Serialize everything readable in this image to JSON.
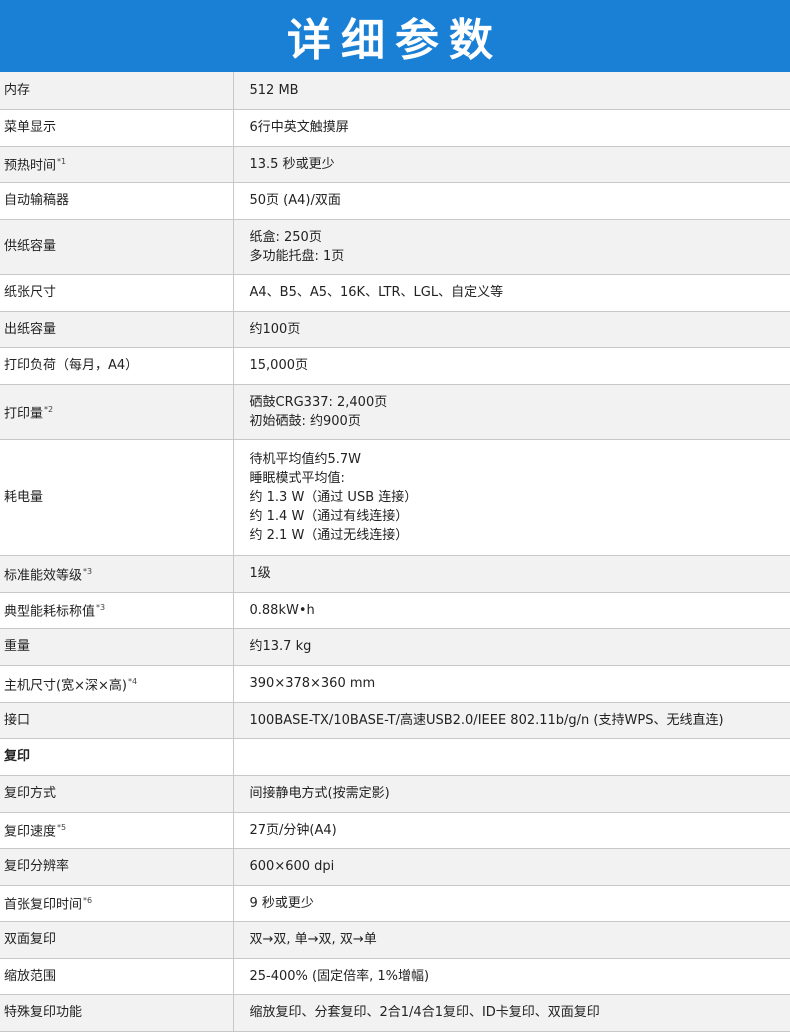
{
  "header": {
    "title": "详细参数"
  },
  "rows": [
    {
      "label": "内存",
      "fn": "",
      "lines": [
        "512 MB"
      ]
    },
    {
      "label": "菜单显示",
      "fn": "",
      "lines": [
        "6行中英文触摸屏"
      ]
    },
    {
      "label": "预热时间",
      "fn": "*1",
      "lines": [
        "13.5 秒或更少"
      ]
    },
    {
      "label": "自动输稿器",
      "fn": "",
      "lines": [
        "50页 (A4)/双面"
      ]
    },
    {
      "label": "供纸容量",
      "fn": "",
      "lines": [
        "纸盒: 250页",
        "多功能托盘: 1页"
      ]
    },
    {
      "label": "纸张尺寸",
      "fn": "",
      "lines": [
        "A4、B5、A5、16K、LTR、LGL、自定义等"
      ]
    },
    {
      "label": "出纸容量",
      "fn": "",
      "lines": [
        "约100页"
      ]
    },
    {
      "label": "打印负荷（每月，A4）",
      "fn": "",
      "lines": [
        "15,000页"
      ]
    },
    {
      "label": "打印量",
      "fn": "*2",
      "lines": [
        "硒鼓CRG337: 2,400页",
        "初始硒鼓: 约900页"
      ]
    },
    {
      "label": "耗电量",
      "fn": "",
      "lines": [
        "待机平均值约5.7W",
        "睡眠模式平均值:",
        "约 1.3 W（通过 USB 连接）",
        "约 1.4 W（通过有线连接）",
        "约 2.1 W（通过无线连接）"
      ]
    },
    {
      "label": "标准能效等级",
      "fn": "*3",
      "lines": [
        "1级"
      ]
    },
    {
      "label": "典型能耗标称值",
      "fn": "*3",
      "lines": [
        "0.88kW•h"
      ]
    },
    {
      "label": "重量",
      "fn": "",
      "lines": [
        "约13.7 kg"
      ]
    },
    {
      "label": "主机尺寸(宽×深×高)",
      "fn": "*4",
      "lines": [
        "390×378×360 mm"
      ]
    },
    {
      "label": "接口",
      "fn": "",
      "lines": [
        "100BASE-TX/10BASE-T/高速USB2.0/IEEE 802.11b/g/n (支持WPS、无线直连)"
      ]
    },
    {
      "label": "复印",
      "fn": "",
      "lines": [],
      "section": true
    },
    {
      "label": "复印方式",
      "fn": "",
      "lines": [
        "间接静电方式(按需定影)"
      ]
    },
    {
      "label": "复印速度",
      "fn": "*5",
      "lines": [
        "27页/分钟(A4)"
      ]
    },
    {
      "label": "复印分辨率",
      "fn": "",
      "lines": [
        "600×600 dpi"
      ]
    },
    {
      "label": "首张复印时间",
      "fn": "*6",
      "lines": [
        "9 秒或更少"
      ]
    },
    {
      "label": "双面复印",
      "fn": "",
      "lines": [
        "双→双, 单→双, 双→单"
      ]
    },
    {
      "label": "缩放范围",
      "fn": "",
      "lines": [
        "25-400% (固定倍率, 1%增幅)"
      ]
    },
    {
      "label": "特殊复印功能",
      "fn": "",
      "lines": [
        "缩放复印、分套复印、2合1/4合1复印、ID卡复印、双面复印"
      ]
    }
  ]
}
